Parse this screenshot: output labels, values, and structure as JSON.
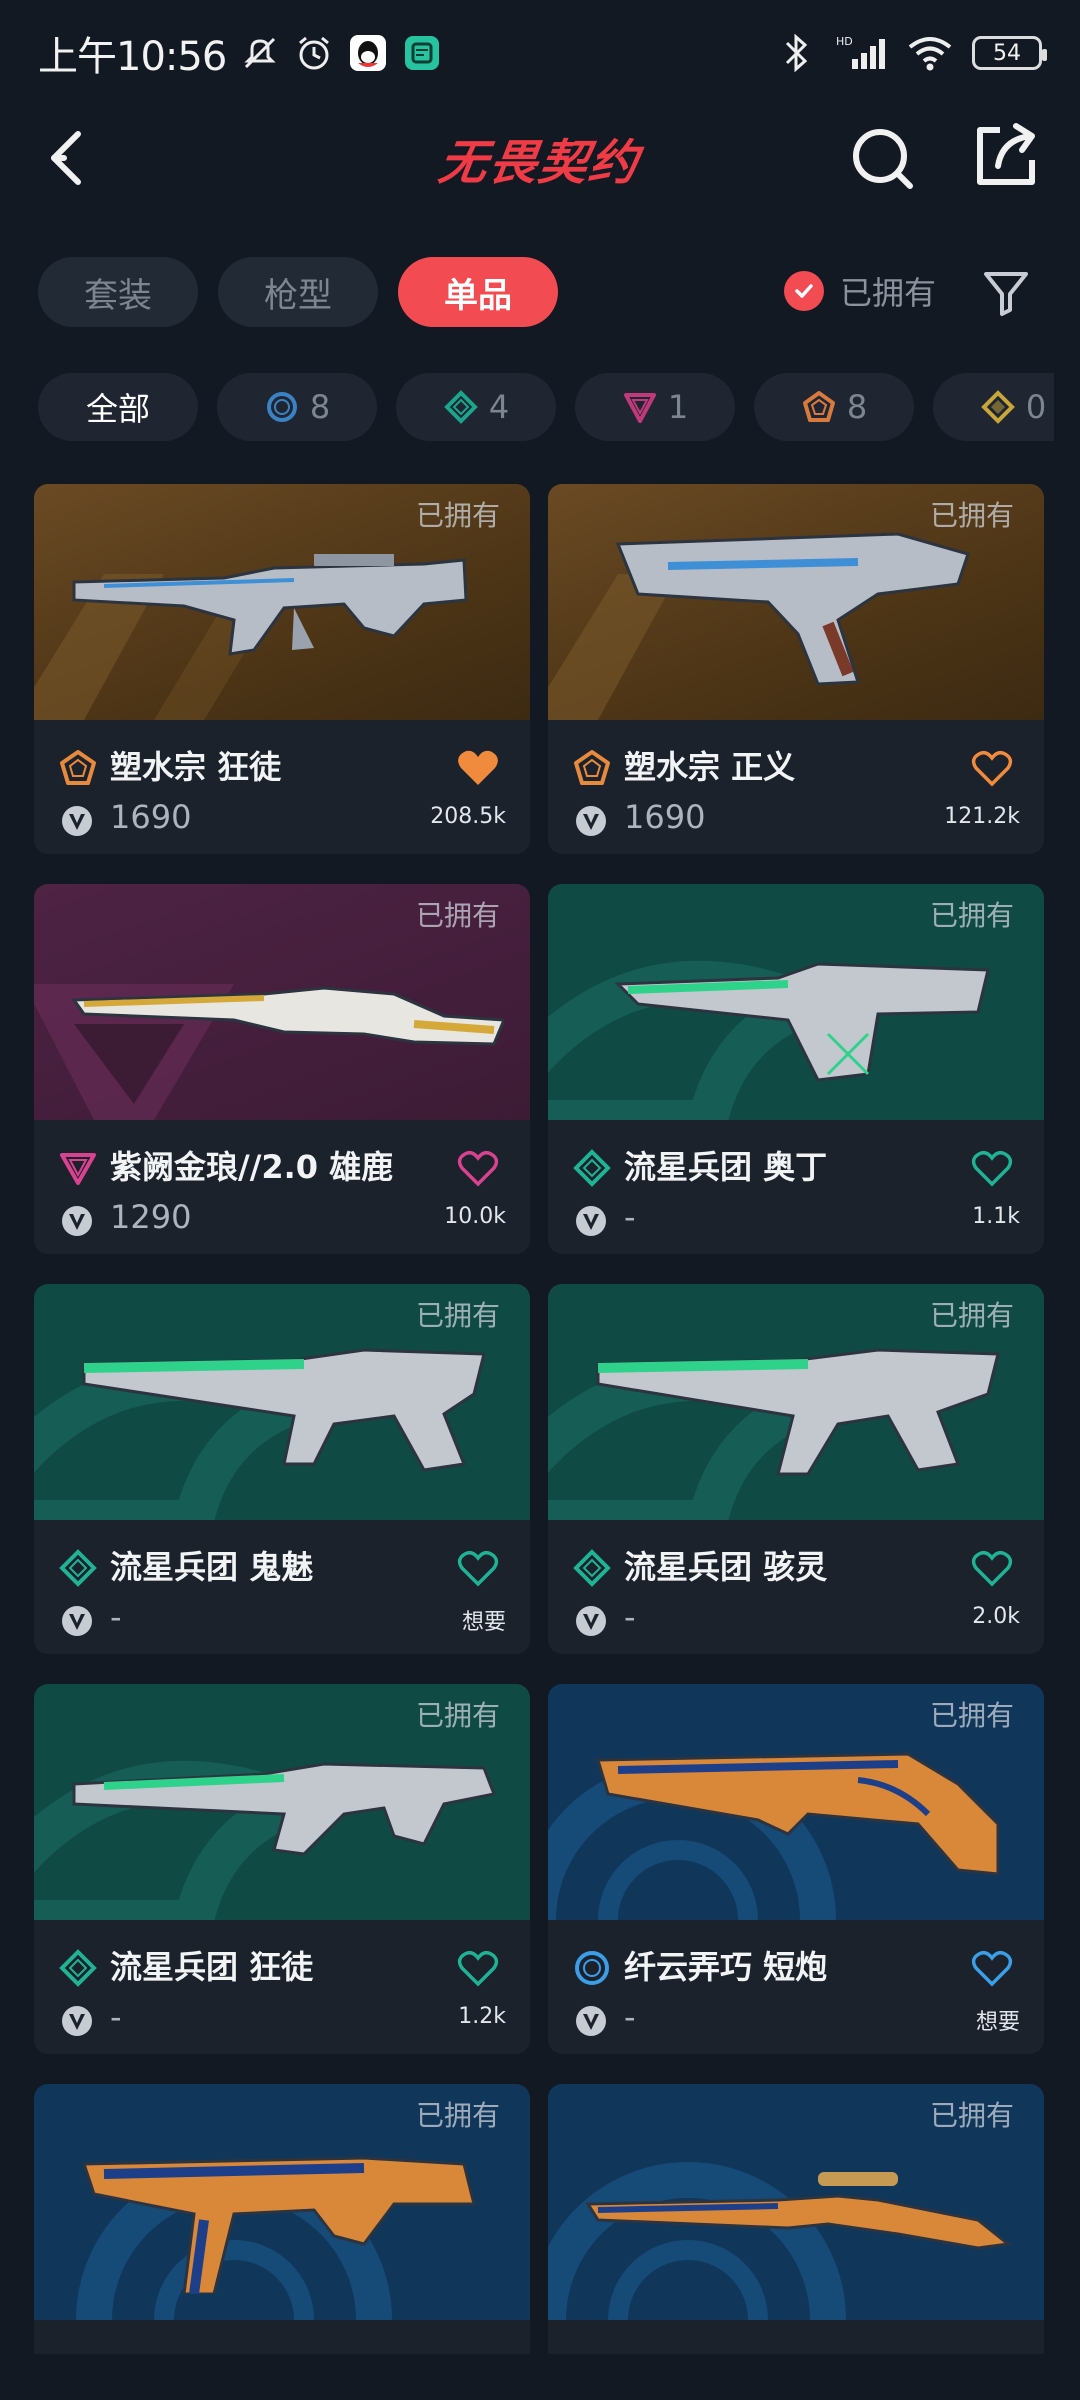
{
  "status": {
    "time": "上午10:56",
    "battery": "54",
    "network": "HD"
  },
  "header": {
    "logo": "无畏契约",
    "back_icon": "chevron-left-icon",
    "search_icon": "search-icon",
    "share_icon": "share-icon"
  },
  "tabs": [
    {
      "label": "套装",
      "active": false
    },
    {
      "label": "枪型",
      "active": false
    },
    {
      "label": "单品",
      "active": true
    }
  ],
  "owned_filter": {
    "label": "已拥有",
    "checked": true
  },
  "chips": [
    {
      "label": "全部",
      "count": ""
    },
    {
      "tier": "select",
      "color": "#3b82c4",
      "count": "8"
    },
    {
      "tier": "deluxe",
      "color": "#1aa58c",
      "count": "4"
    },
    {
      "tier": "premium",
      "color": "#c0397a",
      "count": "1"
    },
    {
      "tier": "exclusive",
      "color": "#d87a3e",
      "count": "8"
    },
    {
      "tier": "ultra",
      "color": "#c9a63a",
      "count": "0"
    }
  ],
  "cards": [
    {
      "name": "塑水宗 狂徒",
      "price": "1690",
      "likes": "208.5k",
      "owned": "已拥有",
      "tier_color": "#e88a3e",
      "heart_filled": true,
      "heart_color": "#f08a3c",
      "bg": "orange"
    },
    {
      "name": "塑水宗 正义",
      "price": "1690",
      "likes": "121.2k",
      "owned": "已拥有",
      "tier_color": "#e88a3e",
      "heart_filled": false,
      "heart_color": "#f08a3c",
      "bg": "orange"
    },
    {
      "name": "紫阙金琅//2.0 雄鹿",
      "price": "1290",
      "likes": "10.0k",
      "owned": "已拥有",
      "tier_color": "#d9428e",
      "heart_filled": false,
      "heart_color": "#d9428e",
      "bg": "purple"
    },
    {
      "name": "流星兵团 奥丁",
      "price": "-",
      "likes": "1.1k",
      "owned": "已拥有",
      "tier_color": "#1fb294",
      "heart_filled": false,
      "heart_color": "#1fb294",
      "bg": "teal"
    },
    {
      "name": "流星兵团 鬼魅",
      "price": "-",
      "likes": "想要",
      "owned": "已拥有",
      "tier_color": "#1fb294",
      "heart_filled": false,
      "heart_color": "#1fb294",
      "bg": "teal"
    },
    {
      "name": "流星兵团 骇灵",
      "price": "-",
      "likes": "2.0k",
      "owned": "已拥有",
      "tier_color": "#1fb294",
      "heart_filled": false,
      "heart_color": "#1fb294",
      "bg": "teal"
    },
    {
      "name": "流星兵团 狂徒",
      "price": "-",
      "likes": "1.2k",
      "owned": "已拥有",
      "tier_color": "#1fb294",
      "heart_filled": false,
      "heart_color": "#1fb294",
      "bg": "teal"
    },
    {
      "name": "纤云弄巧 短炮",
      "price": "-",
      "likes": "想要",
      "owned": "已拥有",
      "tier_color": "#3b9ee6",
      "heart_filled": false,
      "heart_color": "#3b9ee6",
      "bg": "blue"
    },
    {
      "name": "",
      "price": "",
      "likes": "",
      "owned": "已拥有",
      "tier_color": "#3b9ee6",
      "heart_filled": false,
      "heart_color": "#3b9ee6",
      "bg": "blue"
    },
    {
      "name": "",
      "price": "",
      "likes": "",
      "owned": "已拥有",
      "tier_color": "#3b9ee6",
      "heart_filled": false,
      "heart_color": "#3b9ee6",
      "bg": "blue"
    }
  ]
}
